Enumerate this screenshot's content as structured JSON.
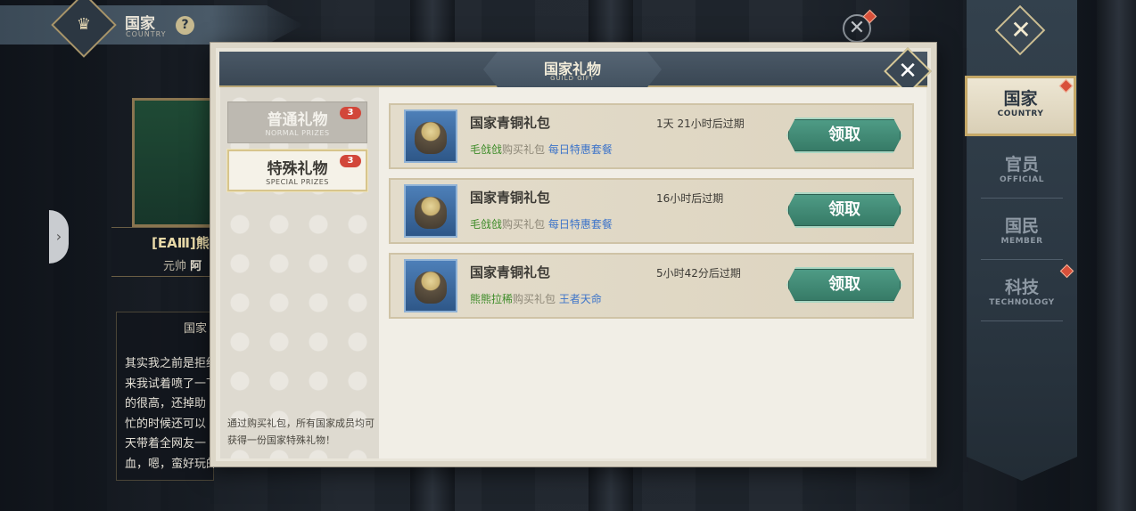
{
  "top_header": {
    "title": "国家",
    "subtitle": "COUNTRY",
    "help": "?"
  },
  "left_panel": {
    "guild_name": "[EAⅢ]熊",
    "rank_label": "元帅",
    "rank_name": "阿",
    "declaration_title": "国家",
    "declaration_text": "其实我之前是拒绝\n来我试着喷了一下\n的很高，还掉助\n忙的时候还可以\n天带着全网友一\n血，嗯，蛮好玩的"
  },
  "side_menu": {
    "close": "✕",
    "items": [
      {
        "cn": "国家",
        "en": "COUNTRY",
        "active": true,
        "red_dot": true
      },
      {
        "cn": "官员",
        "en": "OFFICIAL",
        "active": false,
        "red_dot": false
      },
      {
        "cn": "国民",
        "en": "MEMBER",
        "active": false,
        "red_dot": false
      },
      {
        "cn": "科技",
        "en": "TECHNOLOGY",
        "active": false,
        "red_dot": true
      }
    ]
  },
  "modal": {
    "title": "国家礼物",
    "subtitle": "GUILD GIFT",
    "close": "✕",
    "tabs": [
      {
        "cn": "普通礼物",
        "en": "NORMAL PRIZES",
        "badge": "3",
        "active": false
      },
      {
        "cn": "特殊礼物",
        "en": "SPECIAL PRIZES",
        "badge": "3",
        "active": true
      }
    ],
    "note": "通过购买礼包，所有国家成员均可获得一份国家特殊礼物！",
    "gifts": [
      {
        "name": "国家青铜礼包",
        "expires": "1天 21小时后过期",
        "buyer": "毛戗戗",
        "bought": "购买礼包",
        "pack": "每日特惠套餐",
        "button": "领取"
      },
      {
        "name": "国家青铜礼包",
        "expires": "16小时后过期",
        "buyer": "毛戗戗",
        "bought": "购买礼包",
        "pack": "每日特惠套餐",
        "button": "领取"
      },
      {
        "name": "国家青铜礼包",
        "expires": "5小时42分后过期",
        "buyer": "熊熊拉稀",
        "bought": "购买礼包",
        "pack": "王者天命",
        "button": "领取"
      }
    ]
  },
  "colors": {
    "accent_gold": "#c5a867",
    "claim_green": "#3f8c72",
    "badge_red": "#d2473a",
    "buyer_green": "#3f8c2a",
    "pack_blue": "#3d74c9"
  }
}
